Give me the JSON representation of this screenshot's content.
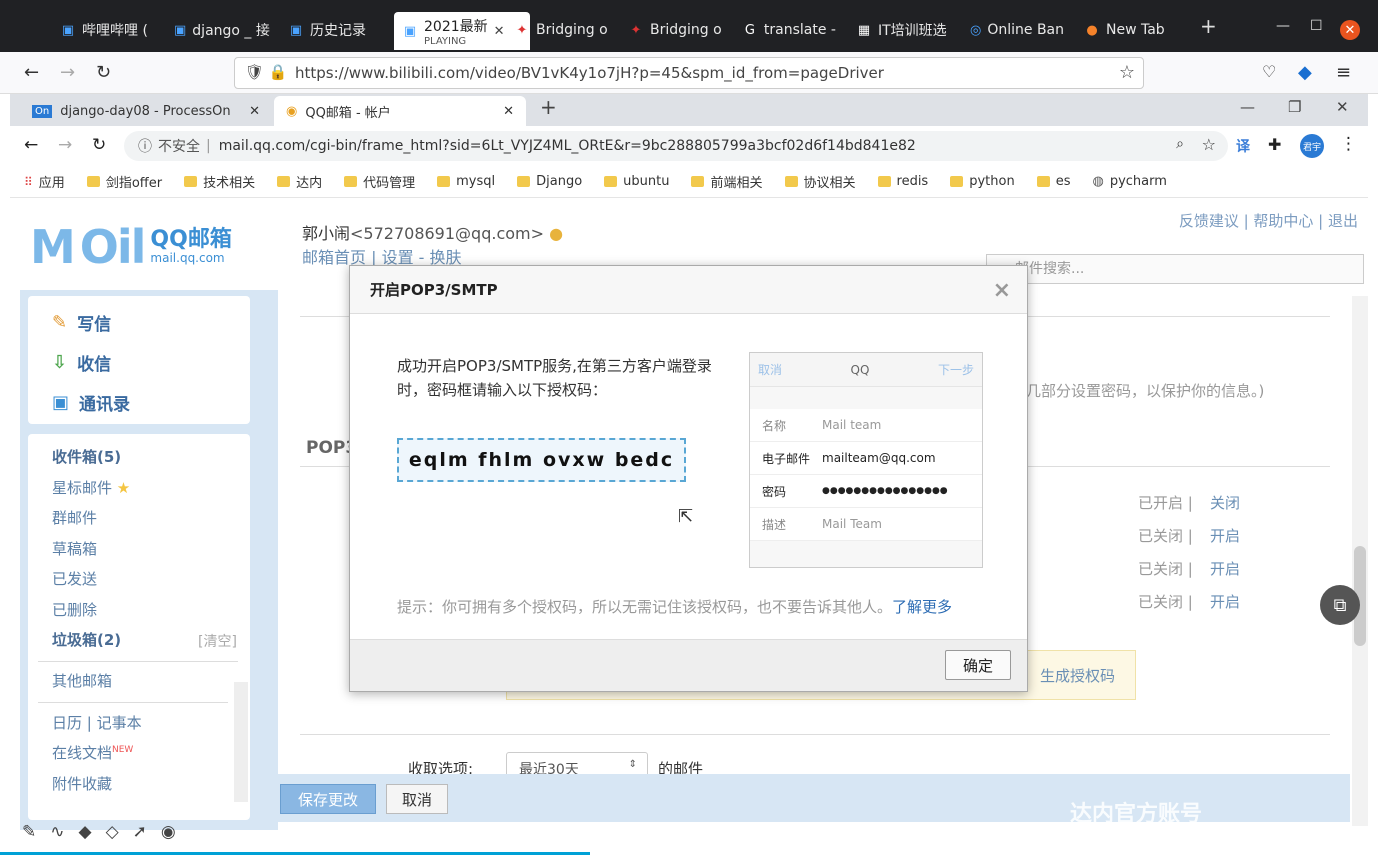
{
  "outer_browser": {
    "tabs": [
      {
        "label": "哔哩哔哩 ("
      },
      {
        "label": "django _ 接"
      },
      {
        "label": "历史记录"
      },
      {
        "label": "2021最新",
        "sub": "PLAYING"
      },
      {
        "label": "Bridging o"
      },
      {
        "label": "Bridging o"
      },
      {
        "label": "translate -"
      },
      {
        "label": "IT培训班选"
      },
      {
        "label": "Online Ban"
      },
      {
        "label": "New Tab"
      }
    ],
    "url": "https://www.bilibili.com/video/BV1vK4y1o7jH?p=45&spm_id_from=pageDriver"
  },
  "inner_browser": {
    "tabs": [
      {
        "label": "django-day08 - ProcessOn"
      },
      {
        "label": "QQ邮箱 - 帐户"
      }
    ],
    "not_secure": "不安全",
    "url": "mail.qq.com/cgi-bin/frame_html?sid=6Lt_VYJZ4ML_ORtE&r=9bc288805799a3bcf02d6f14bd841e82",
    "avatar_label": "君宇",
    "bookmarks": [
      {
        "label": "应用"
      },
      {
        "label": "剑指offer"
      },
      {
        "label": "技术相关"
      },
      {
        "label": "达内"
      },
      {
        "label": "代码管理"
      },
      {
        "label": "mysql"
      },
      {
        "label": "Django"
      },
      {
        "label": "ubuntu"
      },
      {
        "label": "前端相关"
      },
      {
        "label": "协议相关"
      },
      {
        "label": "redis"
      },
      {
        "label": "python"
      },
      {
        "label": "es"
      },
      {
        "label": "pycharm"
      }
    ]
  },
  "mail": {
    "logo_text": "M",
    "logo_big": "Oil",
    "logo_brand": "QQ邮箱",
    "logo_domain": "mail.qq.com",
    "user_name": "郭小闹",
    "user_email": "<572708691@qq.com>",
    "user_links": "邮箱首页 | 设置 - 换肤",
    "top_links": "反馈建议 | 帮助中心 | 退出",
    "search_placeholder": "邮件搜索...",
    "nav": {
      "compose": "写信",
      "inbox": "收信",
      "contacts": "通讯录"
    },
    "folders": {
      "inbox": "收件箱(5)",
      "starred": "星标邮件",
      "group": "群邮件",
      "drafts": "草稿箱",
      "sent": "已发送",
      "deleted": "已删除",
      "spam": "垃圾箱(2)",
      "clear": "[清空]",
      "other": "其他邮箱",
      "calendar": "日历",
      "notes": "记事本",
      "docs": "在线文档",
      "new_badge": "NEW",
      "attachments": "附件收藏"
    },
    "main": {
      "hint": "几部分设置密码，以保护你的信息。)",
      "section_title": "POP3",
      "rows": [
        {
          "status": "已开启 |",
          "action": "关闭"
        },
        {
          "status": "已关闭 |",
          "action": "开启"
        },
        {
          "status": "已关闭 |",
          "action": "开启"
        },
        {
          "status": "已关闭 |",
          "action": "开启"
        }
      ],
      "gen_code": "生成授权码",
      "receive_label": "收取选项:",
      "receive_value": "最近30天",
      "receive_suffix": "的邮件"
    },
    "buttons": {
      "save": "保存更改",
      "cancel": "取消"
    }
  },
  "dialog": {
    "title": "开启POP3/SMTP",
    "description": "成功开启POP3/SMTP服务,在第三方客户端登录时，密码框请输入以下授权码：",
    "auth_code": "eqlm fhlm ovxw bedc",
    "phone": {
      "cancel": "取消",
      "title": "QQ",
      "next": "下一步",
      "rows": [
        {
          "key": "名称",
          "value": "Mail team"
        },
        {
          "key": "电子邮件",
          "value": "mailteam@qq.com"
        },
        {
          "key": "密码",
          "value": "●●●●●●●●●●●●●●●●"
        },
        {
          "key": "描述",
          "value": "Mail Team"
        }
      ]
    },
    "tip": "提示：你可拥有多个授权码，所以无需记住该授权码，也不要告诉其他人。",
    "tip_link": "了解更多",
    "ok": "确定"
  },
  "video_watermark": "达内官方账号"
}
